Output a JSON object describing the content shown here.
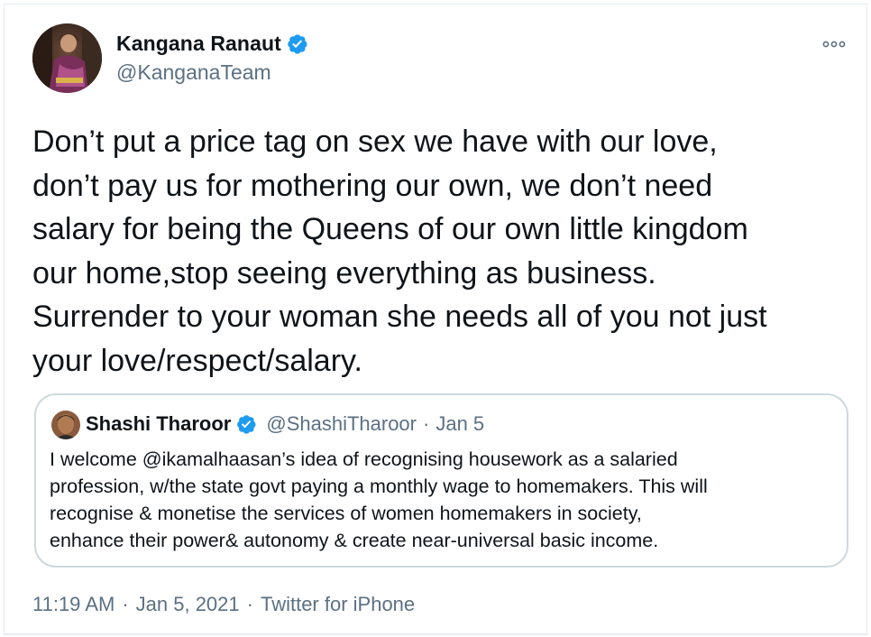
{
  "author": {
    "name": "Kangana Ranaut",
    "handle": "@KanganaTeam",
    "verified_icon": "verified-badge-icon",
    "more_icon": "more-options-icon"
  },
  "tweet": {
    "text": "Don’t put a price tag on sex we have with our love,\ndon’t pay us for mothering our own, we don’t need\nsalary for being the Queens of our own little kingdom\nour home,stop seeing everything as business.\nSurrender to your woman she needs all of you not just\nyour love/respect/salary."
  },
  "quoted_tweet": {
    "name": "Shashi Tharoor",
    "handle": "@ShashiTharoor",
    "separator": "·",
    "date": "Jan 5",
    "text": "I welcome @ikamalhaasan’s idea of  recognising housework as a salaried\nprofession, w/the state govt paying a monthly wage to homemakers. This will\nrecognise & monetise the services of women homemakers in society,\nenhance their power& autonomy & create near-universal basic income."
  },
  "meta": {
    "time": "11:19 AM",
    "separator": "·",
    "date": "Jan 5, 2021",
    "source": "Twitter for iPhone"
  },
  "colors": {
    "text_primary": "#0f1419",
    "text_secondary": "#5b7083",
    "verified_blue": "#1d9bf0",
    "border": "#cfd9de"
  }
}
